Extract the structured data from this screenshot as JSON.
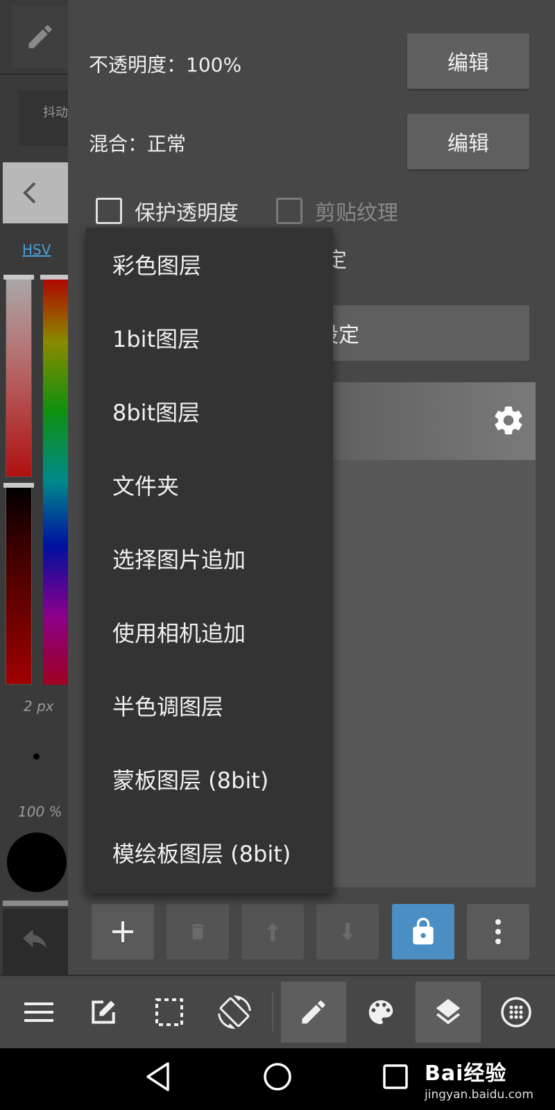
{
  "left_strip": {
    "brush_name": "抖动",
    "color_mode_link": "HSV",
    "brush_size": "2 px",
    "brush_opacity": "100 %"
  },
  "layer_panel": {
    "opacity_label": "不透明度：100%",
    "blend_label": "混合：正常",
    "edit_label": "编辑",
    "protect_alpha_label": "保护透明度",
    "clipping_label": "剪贴纹理",
    "protect_alpha_checked": false,
    "clipping_checked": false,
    "hidden_row_text": "定",
    "settings_button_text": "设定"
  },
  "add_layer_menu": {
    "items": [
      "彩色图层",
      "1bit图层",
      "8bit图层",
      "文件夹",
      "选择图片追加",
      "使用相机追加",
      "半色调图层",
      "蒙板图层 (8bit)",
      "模绘板图层 (8bit)"
    ]
  },
  "layer_toolbar": {
    "buttons": [
      "plus-icon",
      "trash-icon",
      "arrow-up-icon",
      "arrow-down-icon",
      "lock-icon",
      "more-vertical-icon"
    ],
    "lock_color": "#4a8ec4"
  },
  "main_toolbar": {
    "buttons": [
      "menu-icon",
      "edit-square-icon",
      "selection-icon",
      "rotate-screen-icon",
      "pen-icon",
      "palette-icon",
      "layers-icon",
      "grid-circle-icon"
    ],
    "active": [
      "pen-icon",
      "layers-icon"
    ]
  },
  "watermark": {
    "brand": "Bai经验",
    "url": "jingyan.baidu.com"
  }
}
